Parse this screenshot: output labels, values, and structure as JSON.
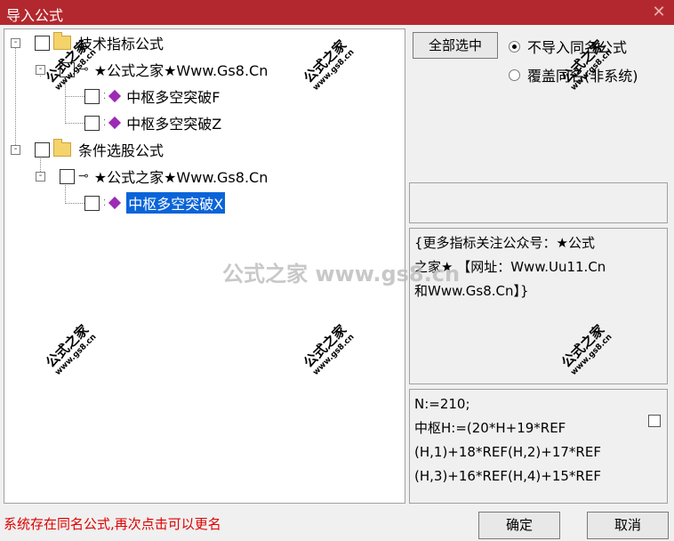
{
  "window": {
    "title": "导入公式",
    "close_glyph": "✕"
  },
  "tree": {
    "root1": {
      "label": "技术指标公式"
    },
    "child1": {
      "label": "★公式之家★Www.Gs8.Cn"
    },
    "leaf1": {
      "label": "中枢多空突破F"
    },
    "leaf2": {
      "label": "中枢多空突破Z"
    },
    "root2": {
      "label": "条件选股公式"
    },
    "child2": {
      "label": "★公式之家★Www.Gs8.Cn"
    },
    "leaf3": {
      "label": "中枢多空突破X"
    },
    "expander": "-"
  },
  "buttons": {
    "select_all": "全部选中",
    "ok": "确定",
    "cancel": "取消"
  },
  "radios": {
    "opt1": "不导入同名公式",
    "opt2": "覆盖同名(非系统)",
    "selected": "opt1"
  },
  "description": {
    "line1": "{更多指标关注公众号：★公式",
    "line2": "之家★ 【网址：Www.Uu11.Cn",
    "line3": "和Www.Gs8.Cn】}"
  },
  "code": {
    "line1": "N:=210;",
    "line2": "中枢H:=(20*H+19*REF",
    "line3": "(H,1)+18*REF(H,2)+17*REF",
    "line4": "(H,3)+16*REF(H,4)+15*REF"
  },
  "status": "系统存在同名公式,再次点击可以更名",
  "watermark": {
    "text": "公式之家",
    "url": "www.gs8.cn",
    "center": "公式之家 www.gs8.cn"
  },
  "colors": {
    "titlebar": "#b3282e",
    "selection": "#0a64d8",
    "status": "#e00000"
  }
}
